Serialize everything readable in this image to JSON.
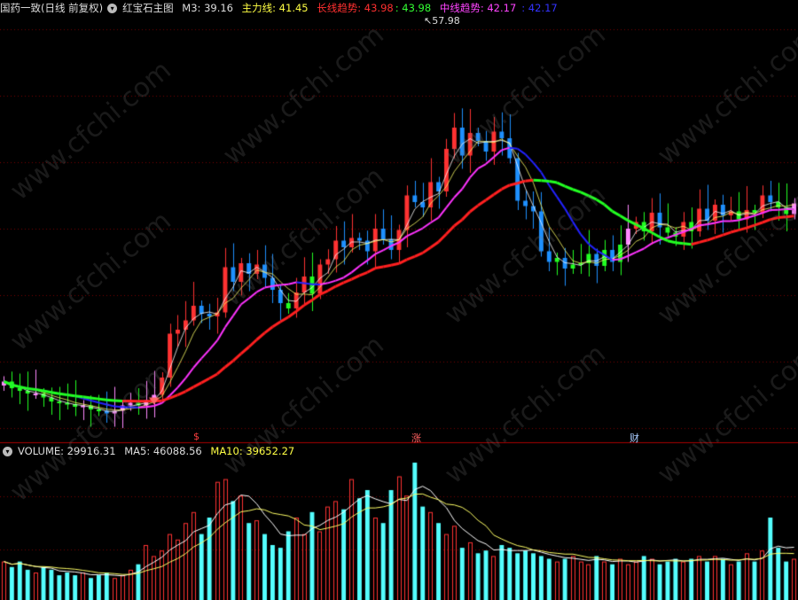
{
  "header": {
    "stock": "国药一致(日线 前复权)",
    "indicator": "红宝石主图",
    "m3": "M3: 39.16",
    "zhuli": "主力线: 41.45",
    "changxian": "长线趋势: 43.98",
    "changxian_val2": ": 43.98",
    "zhongxian": "中线趋势: 42.17",
    "zhongxian_val2": ": 42.17"
  },
  "volume_header": {
    "volume": "VOLUME: 29916.31",
    "ma5": "MA5: 46088.56",
    "ma10": "MA10: 39652.27"
  },
  "watermark": "www.cfchi.com",
  "markers": {
    "high_label": "57.98",
    "sig1": "$",
    "sig2": "涨",
    "sig3": "财"
  },
  "colors": {
    "up": "#ff3232",
    "down": "#54ffff",
    "red_line": "#ff2020",
    "magenta_line": "#ff33ff",
    "blue_line": "#2222ff",
    "green_line": "#22ff22",
    "yellow_line": "#ffff66",
    "white_line": "#ffffff",
    "grid": "#7a0000",
    "pink_candle": "#ff88ff",
    "blue_candle": "#1e90ff",
    "green_candle": "#22ff22"
  },
  "chart_data": {
    "type": "candlestick",
    "price_range": [
      27,
      59
    ],
    "high_marker": 57.98,
    "close_prices": [
      31.5,
      31.0,
      30.8,
      30.6,
      30.6,
      30.3,
      30.0,
      29.9,
      29.8,
      29.6,
      29.7,
      29.4,
      29.3,
      29.1,
      29.3,
      29.7,
      29.9,
      29.7,
      30.1,
      30.5,
      31.8,
      35.1,
      35.4,
      36.1,
      37.2,
      36.6,
      36.4,
      36.7,
      40.1,
      39.0,
      40.4,
      39.6,
      40.3,
      39.3,
      38.4,
      37.4,
      37.0,
      38.2,
      39.4,
      38.1,
      40.3,
      40.7,
      42.1,
      41.6,
      42.3,
      42.1,
      41.3,
      43.0,
      42.2,
      41.4,
      42.9,
      45.5,
      45.0,
      44.6,
      46.5,
      45.8,
      49.0,
      50.6,
      48.5,
      50.2,
      49.6,
      48.8,
      50.3,
      49.8,
      48.3,
      45.1,
      44.7,
      44.3,
      41.3,
      40.5,
      40.8,
      40.0,
      40.3,
      40.4,
      41.1,
      40.2,
      41.4,
      40.5,
      41.8,
      43.0,
      43.5,
      42.8,
      44.2,
      43.1,
      42.7,
      42.4,
      43.5,
      42.8,
      44.5,
      43.6,
      44.8,
      44.0,
      44.3,
      43.7,
      44.4,
      44.2,
      45.5,
      45.0,
      44.6,
      44.1,
      44.9
    ],
    "volumes": [
      7.0,
      6.0,
      7.0,
      5.5,
      5.0,
      6.0,
      5.5,
      4.5,
      5.0,
      4.5,
      5.0,
      4.0,
      4.5,
      5.0,
      4.0,
      4.5,
      5.5,
      6.5,
      10.0,
      8.0,
      9.0,
      12.0,
      11.0,
      14.0,
      16.0,
      12.0,
      15.0,
      21.5,
      22.0,
      18.0,
      19.0,
      14.0,
      14.5,
      12.0,
      10.0,
      9.5,
      12.5,
      15.0,
      12.0,
      16.0,
      12.5,
      17.0,
      18.0,
      16.5,
      22.0,
      18.5,
      20.0,
      15.0,
      14.0,
      20.0,
      22.5,
      19.0,
      25.0,
      17.0,
      16.0,
      14.0,
      12.0,
      13.5,
      9.5,
      10.5,
      8.5,
      9.0,
      8.0,
      10.0,
      9.5,
      8.5,
      9.0,
      8.5,
      8.0,
      7.5,
      7.0,
      7.5,
      8.0,
      7.0,
      6.5,
      8.0,
      7.0,
      6.5,
      7.5,
      6.5,
      7.0,
      8.0,
      7.5,
      6.5,
      7.0,
      7.5,
      7.0,
      7.5,
      8.0,
      7.0,
      8.0,
      7.5,
      6.5,
      7.0,
      8.5,
      7.0,
      9.0,
      15.0,
      9.5,
      7.0,
      7.5
    ]
  }
}
